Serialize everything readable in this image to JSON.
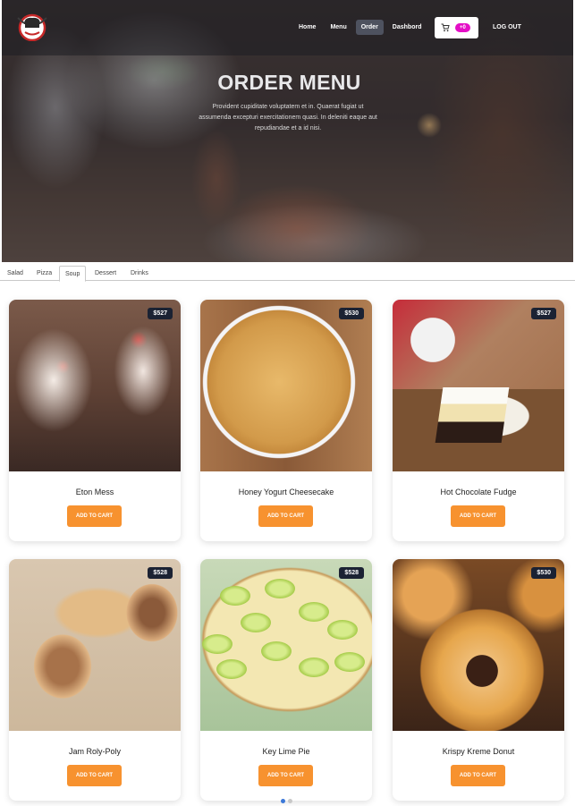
{
  "nav": {
    "links": [
      {
        "label": "Home",
        "active": false
      },
      {
        "label": "Menu",
        "active": false
      },
      {
        "label": "Order",
        "active": true
      },
      {
        "label": "Dashbord",
        "active": false
      }
    ],
    "cart_count": "+0",
    "logout_label": "LOG OUT"
  },
  "hero": {
    "title": "ORDER MENU",
    "subtitle": "Provident cupiditate voluptatem et in. Quaerat fugiat ut assumenda excepturi exercitationem quasi. In deleniti eaque aut repudiandae et a id nisi."
  },
  "tabs": [
    {
      "label": "Salad",
      "active": false
    },
    {
      "label": "Pizza",
      "active": false
    },
    {
      "label": "Soup",
      "active": true
    },
    {
      "label": "Dessert",
      "active": false
    },
    {
      "label": "Drinks",
      "active": false
    }
  ],
  "products": [
    {
      "name": "Eton Mess",
      "price": "$527",
      "button": "ADD TO CART"
    },
    {
      "name": "Honey Yogurt Cheesecake",
      "price": "$530",
      "button": "ADD TO CART"
    },
    {
      "name": "Hot Chocolate Fudge",
      "price": "$527",
      "button": "ADD TO CART"
    },
    {
      "name": "Jam Roly-Poly",
      "price": "$528",
      "button": "ADD TO CART"
    },
    {
      "name": "Key Lime Pie",
      "price": "$528",
      "button": "ADD TO CART"
    },
    {
      "name": "Krispy Kreme Donut",
      "price": "$530",
      "button": "ADD TO CART"
    }
  ],
  "colors": {
    "accent_orange": "#f7922f",
    "badge_magenta": "#e40ec6",
    "price_tag": "#1b2233"
  },
  "icons": [
    "chef-logo-icon",
    "cart-icon"
  ]
}
